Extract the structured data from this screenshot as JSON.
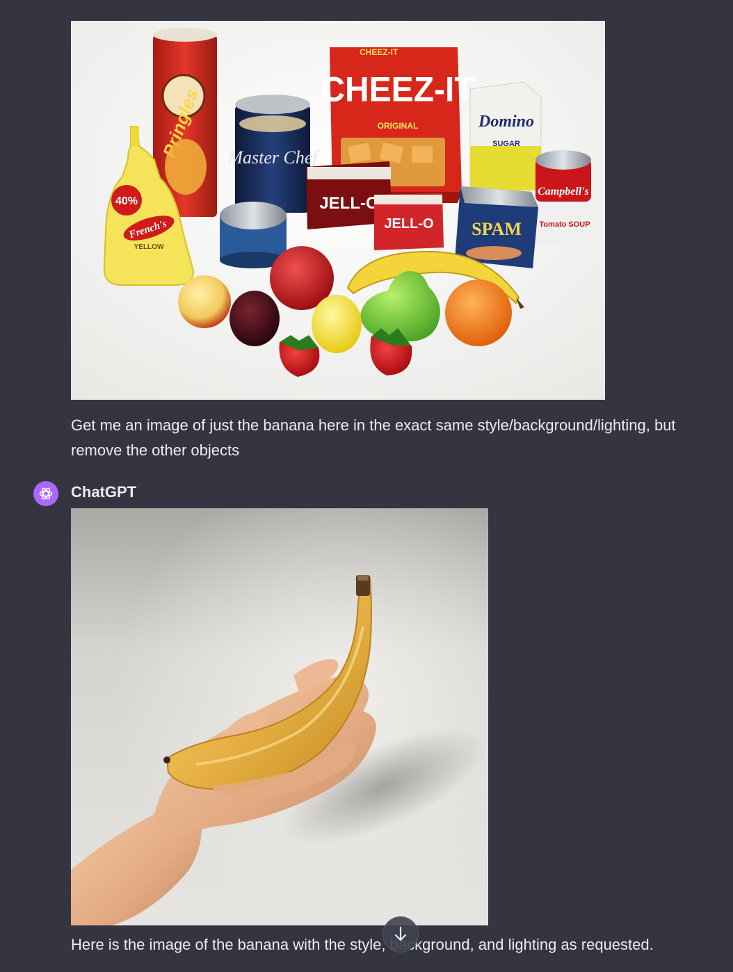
{
  "conversation": {
    "user_message": {
      "text": "Get me an image of just the banana here in the exact same style/background/lighting, but remove the other objects"
    },
    "assistant_message": {
      "author": "ChatGPT",
      "text": "Here is the image of the banana with the style, background, and lighting as requested."
    }
  },
  "user_image_labels": {
    "cheezit_top": "CHEEZ-IT",
    "cheezit": "CHEEZ-IT",
    "cheezit_sub": "ORIGINAL",
    "pringles": "Pringles",
    "frenchs_promo": "40%",
    "frenchs": "French's",
    "frenchs_sub": "YELLOW",
    "masterchef": "Master Chef",
    "domino": "Domino",
    "domino_sub": "SUGAR",
    "jello": "JELL-O",
    "jello2": "JELL-O",
    "spam": "SPAM",
    "campbells": "Campbell's",
    "campbells_sub": "Tomato SOUP"
  },
  "icons": {
    "avatar": "openai-logo-icon",
    "scroll": "arrow-down-icon"
  },
  "colors": {
    "background": "#343541",
    "text": "#ececf1",
    "avatar_bg": "#ab68ff"
  }
}
